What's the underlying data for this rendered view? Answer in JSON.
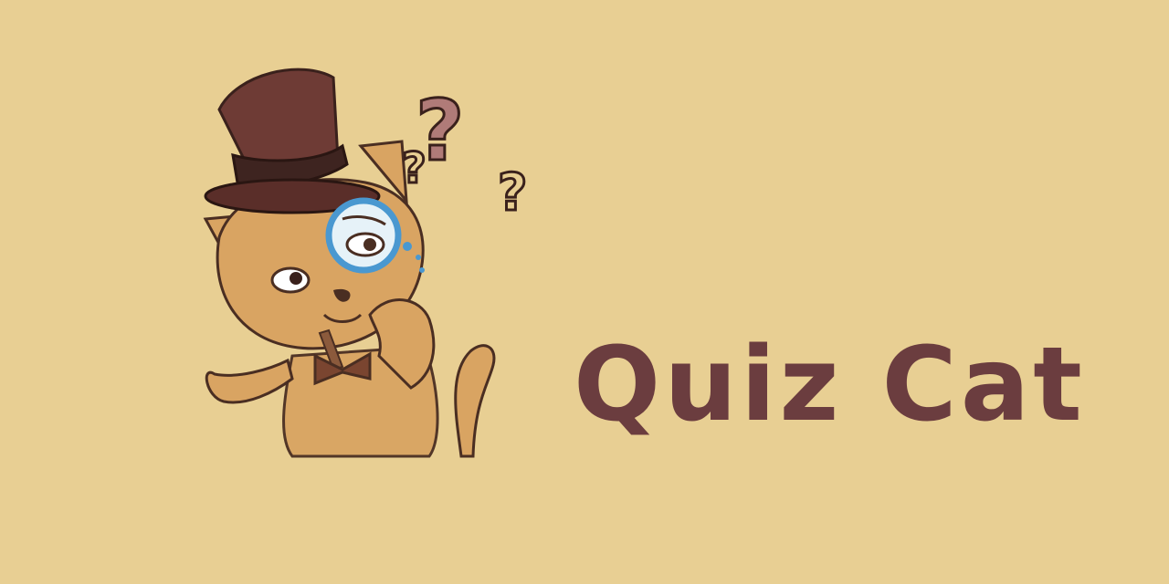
{
  "title": "Quiz Cat",
  "colors": {
    "background": "#E8CF93",
    "title": "#6B3D3F",
    "hat": "#6E3B35",
    "question_marks": "#B07B78",
    "cat_fur": "#D9A462",
    "outline": "#4A2E22",
    "monocle": "#4A98D0"
  },
  "mascot": {
    "icon": "cat-with-top-hat-and-monocle"
  }
}
